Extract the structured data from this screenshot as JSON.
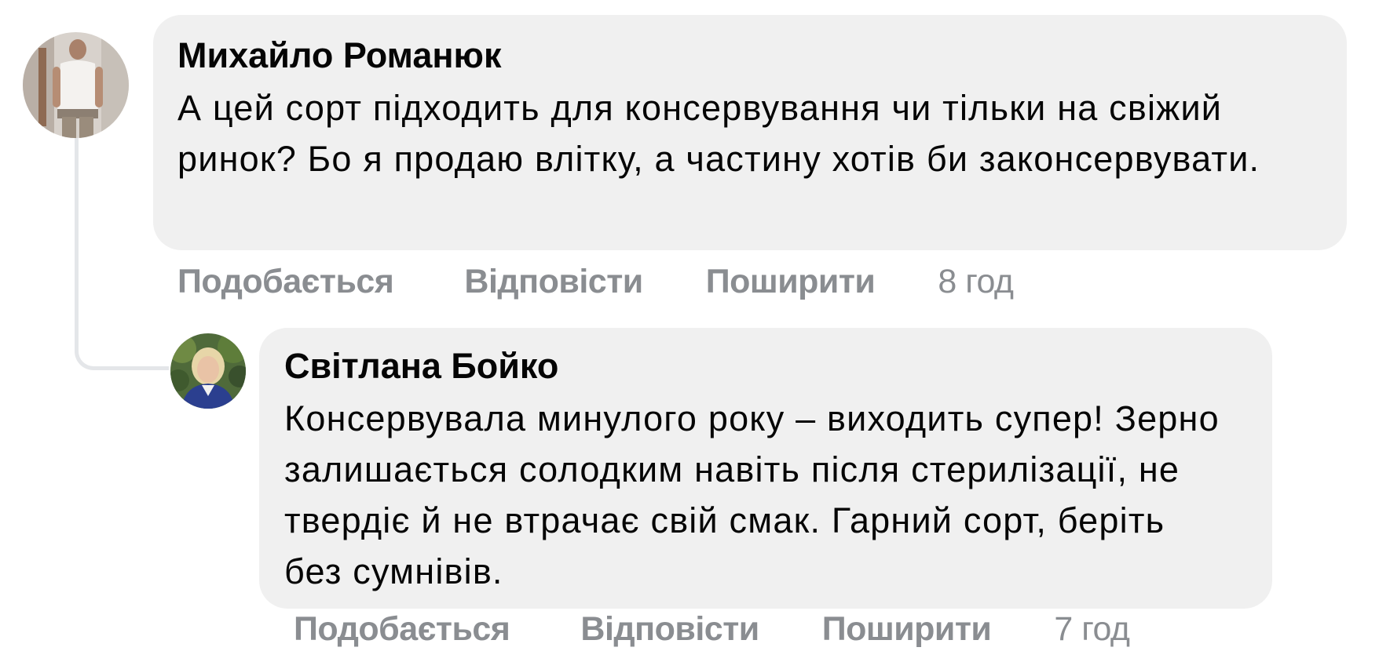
{
  "comment": {
    "author": "Михайло Романюк",
    "text": "А цей сорт підходить для консервування чи тільки на свіжий ринок? Бо я продаю влітку, а частину хотів би законсервувати.",
    "actions": {
      "like": "Подобається",
      "reply": "Відповісти",
      "share": "Поширити",
      "time": "8 год"
    }
  },
  "reply": {
    "author": "Світлана Бойко",
    "text": "Консервувала минулого року – виходить супер! Зерно залишається солодким навіть після стерилізації, не твердіє й не втрачає свій смак. Гарний сорт, беріть без сумнівів.",
    "actions": {
      "like": "Подобається",
      "reply": "Відповісти",
      "share": "Поширити",
      "time": "7 год"
    }
  },
  "colors": {
    "bubble": "#f0f0f0",
    "text": "#050505",
    "meta": "#8a8d91",
    "thread_line": "#e4e6e9"
  },
  "icons": [
    "avatar-photo"
  ]
}
